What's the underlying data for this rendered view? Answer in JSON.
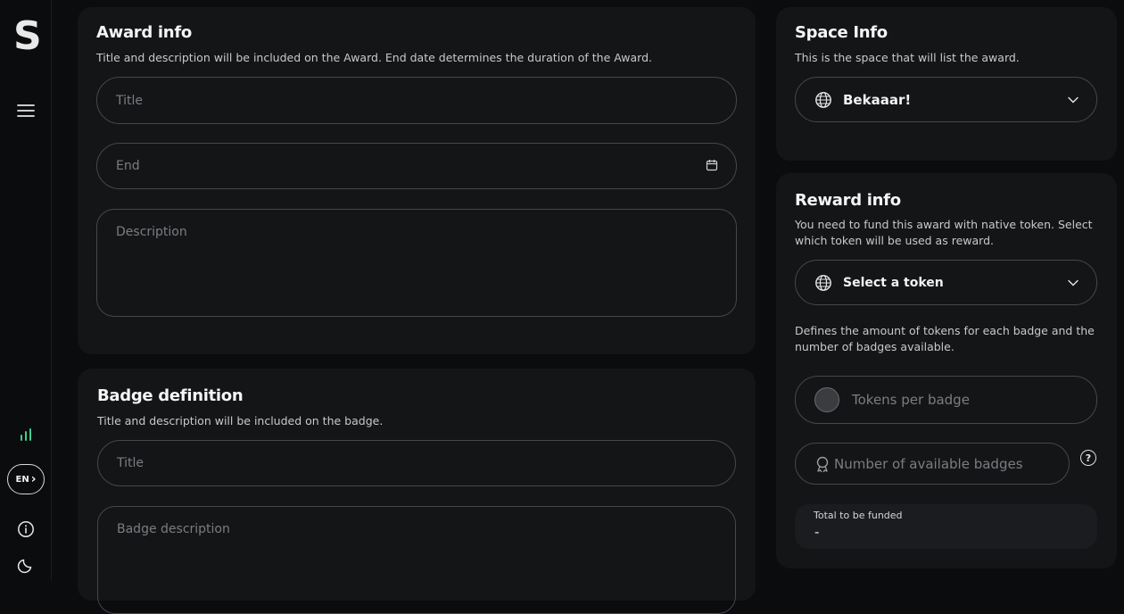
{
  "sidebar": {
    "logo": "S",
    "lang_label": "EN",
    "lang_chevron": "›",
    "icons": [
      "menu-icon",
      "stats-icon",
      "info-icon",
      "moon-icon"
    ]
  },
  "award_info": {
    "title": "Award info",
    "subtitle": "Title and description will be included on the Award. End date determines the duration of the Award.",
    "title_placeholder": "Title",
    "end_placeholder": "End",
    "description_placeholder": "Description"
  },
  "badge_definition": {
    "title": "Badge definition",
    "subtitle": "Title and description will be included on the badge.",
    "title_placeholder": "Title",
    "description_placeholder": "Badge description"
  },
  "space_info": {
    "title": "Space Info",
    "subtitle": "This is the space that will list the award.",
    "selected_space": "Bekaaar!"
  },
  "reward_info": {
    "title": "Reward info",
    "subtitle": "You need to fund this award with native token. Select which token will be used as reward.",
    "token_select": "Select a token",
    "amount_note": "Defines the amount of tokens for each badge and the number of badges available.",
    "tokens_per_badge_placeholder": "Tokens per badge",
    "available_badges_placeholder": "Number of available badges",
    "help_icon": "?",
    "total_label": "Total to be funded",
    "total_value": "-"
  },
  "colors": {
    "background": "#0b0c0e",
    "card": "#141517",
    "border": "#45474c",
    "accent_green": "#3ecf8e"
  }
}
